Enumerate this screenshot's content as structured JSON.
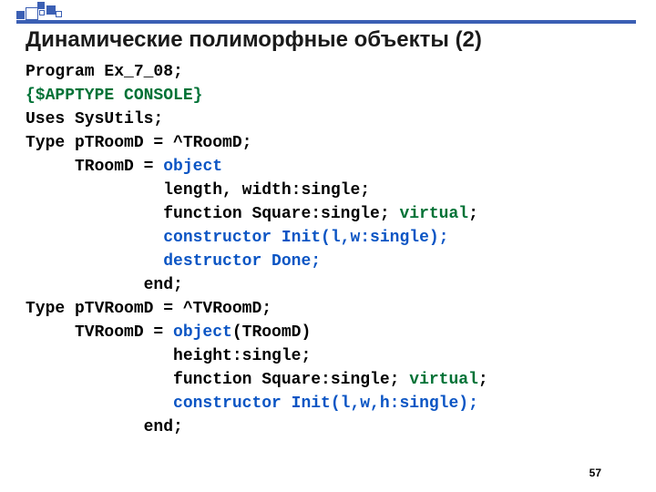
{
  "title": "Динамические полиморфные объекты (2)",
  "page_number": "57",
  "code": {
    "l01": "Program Ex_7_08;",
    "l02": "{$APPTYPE CONSOLE}",
    "l03": "Uses SysUtils;",
    "l04": "Type pTRoomD = ^TRoomD;",
    "l05a": "     TRoomD = ",
    "l05b": "object",
    "l06": "              length, width:single;",
    "l07a": "              function Square:single; ",
    "l07b": "virtual",
    "l07c": ";",
    "l08": "              constructor Init(l,w:single);",
    "l09": "              destructor Done;",
    "l10": "            end;",
    "l11": "Type pTVRoomD = ^TVRoomD;",
    "l12a": "     TVRoomD = ",
    "l12b": "object",
    "l12c": "(TRoomD)",
    "l13": "               height:single;",
    "l14a": "               function Square:single; ",
    "l14b": "virtual",
    "l14c": ";",
    "l15": "               constructor Init(l,w,h:single);",
    "l16": "            end;"
  }
}
